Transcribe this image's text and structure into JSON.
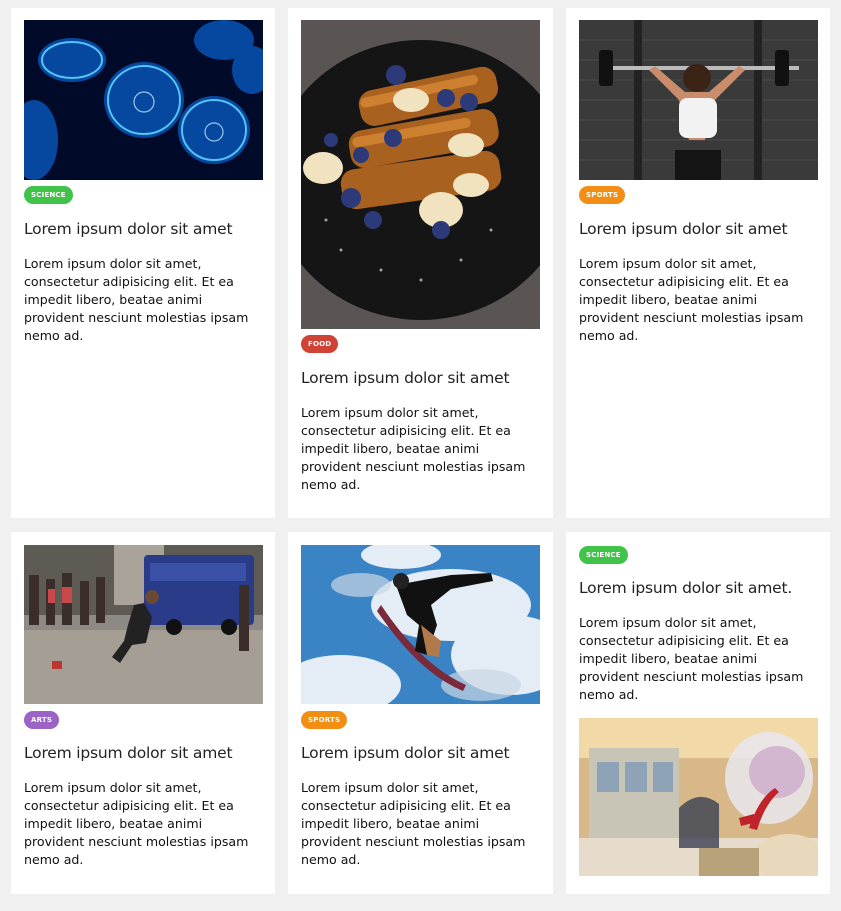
{
  "colors": {
    "science": "#41c34a",
    "food": "#d14236",
    "sports": "#f18e13",
    "arts": "#9b63c5",
    "page_background": "#f0f0f0",
    "card_background": "#ffffff"
  },
  "cards": [
    {
      "category": "Science",
      "image": "jellyfish-photo",
      "title": "Lorem ipsum dolor sit amet",
      "text": "Lorem ipsum dolor sit amet, consectetur adipisicing elit. Et ea impedit libero, beatae animi provident nesciunt molestias ipsam nemo ad."
    },
    {
      "category": "Food",
      "image": "french-toast-photo",
      "title": "Lorem ipsum dolor sit amet",
      "text": "Lorem ipsum dolor sit amet, consectetur adipisicing elit. Et ea impedit libero, beatae animi provident nesciunt molestias ipsam nemo ad."
    },
    {
      "category": "Sports",
      "image": "weightlifting-photo",
      "title": "Lorem ipsum dolor sit amet",
      "text": "Lorem ipsum dolor sit amet, consectetur adipisicing elit. Et ea impedit libero, beatae animi provident nesciunt molestias ipsam nemo ad."
    },
    {
      "category": "Arts",
      "image": "street-dancer-photo",
      "title": "Lorem ipsum dolor sit amet",
      "text": "Lorem ipsum dolor sit amet, consectetur adipisicing elit. Et ea impedit libero, beatae animi provident nesciunt molestias ipsam nemo ad."
    },
    {
      "category": "Sports",
      "image": "snowboarder-photo",
      "title": "Lorem ipsum dolor sit amet",
      "text": "Lorem ipsum dolor sit amet, consectetur adipisicing elit. Et ea impedit libero, beatae animi provident nesciunt molestias ipsam nemo ad."
    },
    {
      "category": "Science",
      "image": "anatomy-model-photo",
      "title": "Lorem ipsum dolor sit amet.",
      "text": "Lorem ipsum dolor sit amet, consectetur adipisicing elit. Et ea impedit libero, beatae animi provident nesciunt molestias ipsam nemo ad."
    }
  ]
}
